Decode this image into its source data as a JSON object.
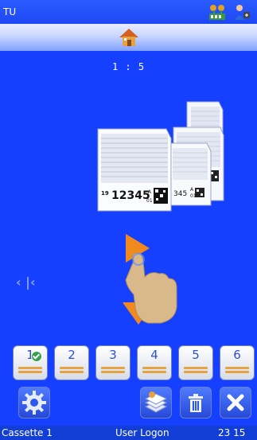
{
  "statusbar": {
    "app_label": "TU",
    "icons": [
      "network-icon",
      "user-transfer-icon"
    ]
  },
  "homebar": {
    "icon": "home-icon"
  },
  "display": {
    "ratio_text": "1 : 5"
  },
  "cassettes": {
    "front_number": "12345",
    "front_prefix": "19",
    "front_letter": "A",
    "front_sub": "01",
    "back_number": "345",
    "back_letter": "A",
    "back_sub": "01"
  },
  "navigation": {
    "prev_label": "‹ |‹"
  },
  "tabs": [
    {
      "label": "1",
      "selected": true
    },
    {
      "label": "2"
    },
    {
      "label": "3"
    },
    {
      "label": "4"
    },
    {
      "label": "5"
    },
    {
      "label": "6"
    }
  ],
  "toolbar": {
    "settings_icon": "gear-icon",
    "layers_icon": "layers-icon",
    "trash_icon": "trash-icon",
    "close_icon": "close-icon"
  },
  "footer": {
    "left": "Cassette 1",
    "center": "User Logon",
    "right": "23 15"
  },
  "colors": {
    "background": "#1540ff",
    "accent_orange": "#f08a1e",
    "tab_bar": "#e7a23f"
  }
}
